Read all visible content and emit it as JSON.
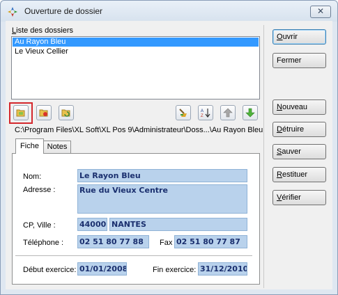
{
  "window": {
    "title": "Ouverture de dossier",
    "close_glyph": "✕"
  },
  "folders": {
    "label": "Liste des dossiers",
    "items": [
      "Au Rayon Bleu",
      "Le Vieux Cellier"
    ],
    "selected_index": 0
  },
  "toolbar": {
    "left": [
      "open-folder-icon",
      "remove-folder-icon",
      "refresh-folder-icon"
    ],
    "right": [
      "broom-icon",
      "sort-az-icon",
      "arrow-up-icon",
      "arrow-down-icon"
    ]
  },
  "path": "C:\\Program Files\\XL Soft\\XL Pos 9\\Administrateur\\Doss...\\Au Rayon Bleu",
  "buttons": {
    "ouvrir": "Ouvrir",
    "fermer": "Fermer",
    "nouveau": "Nouveau",
    "detruire": "Détruire",
    "sauver": "Sauver",
    "restituer": "Restituer",
    "verifier": "Vérifier"
  },
  "tabs": {
    "fiche": "Fiche",
    "notes": "Notes"
  },
  "form": {
    "nom_label": "Nom:",
    "nom": "Le Rayon Bleu",
    "adresse_label": "Adresse :",
    "adresse": "Rue du Vieux Centre",
    "cp_label": "CP, Ville :",
    "cp": "44000",
    "ville": "NANTES",
    "tel_label": "Téléphone :",
    "tel": "02 51 80 77 88",
    "fax_label": "Fax :",
    "fax": "02 51 80 77 87",
    "debut_label": "Début exercice:",
    "debut": "01/01/2008",
    "fin_label": "Fin exercice:",
    "fin": "31/12/2010"
  }
}
